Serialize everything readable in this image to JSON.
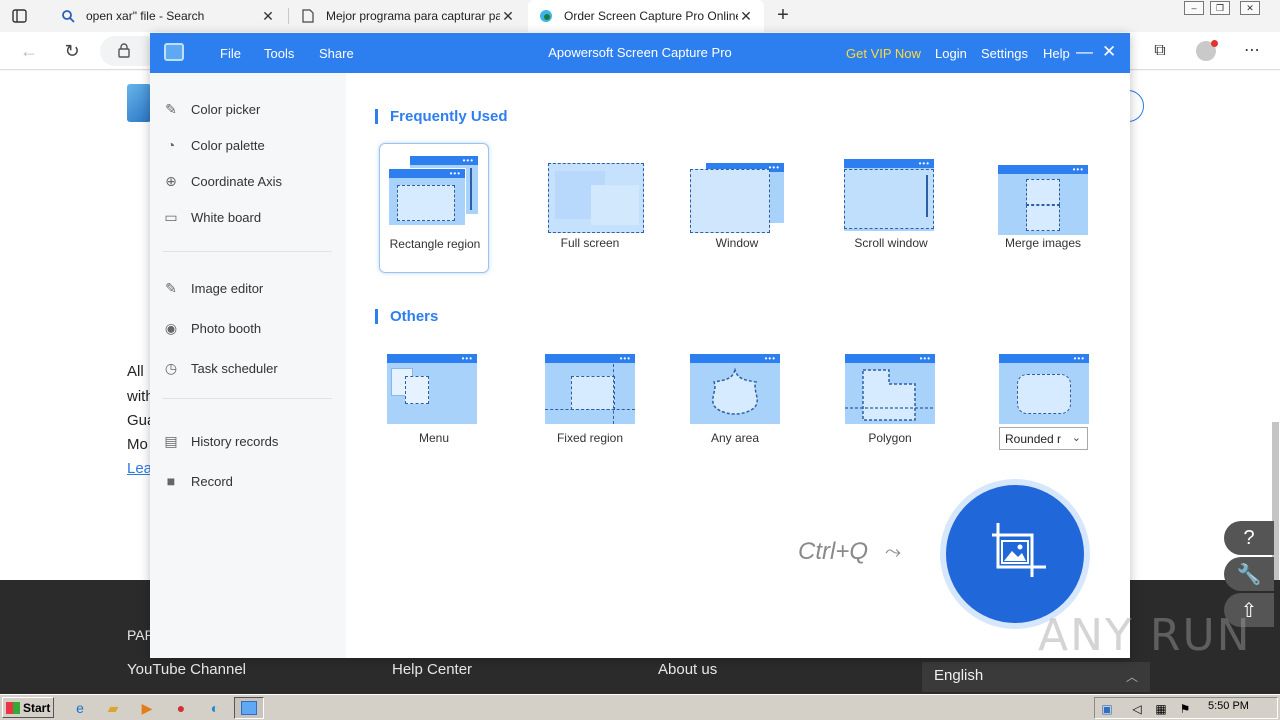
{
  "browser": {
    "tabs": [
      {
        "title": "open xar\" file - Search",
        "icon": "search-icon"
      },
      {
        "title": "Mejor programa para capturar pa",
        "icon": "page-icon"
      },
      {
        "title": "Order Screen Capture Pro Online",
        "icon": "edge-icon"
      }
    ],
    "new_tab_glyph": "+"
  },
  "webpage": {
    "text_lines": [
      "All",
      "with",
      "Gua",
      "Mo"
    ],
    "link_text": "Lea",
    "footer_head": "PAR",
    "footer_links": [
      "YouTube Channel",
      "Help Center",
      "About us"
    ],
    "language": "English"
  },
  "app": {
    "name": "Apowersoft Screen Capture Pro",
    "menu": [
      "File",
      "Tools",
      "Share"
    ],
    "vip_label": "Get VIP Now",
    "login_label": "Login",
    "settings_label": "Settings",
    "help_label": "Help",
    "sidebar": {
      "group1": [
        "Color picker",
        "Color palette",
        "Coordinate Axis",
        "White board"
      ],
      "group2": [
        "Image editor",
        "Photo booth",
        "Task scheduler"
      ],
      "group3": [
        "History records",
        "Record"
      ]
    },
    "frequently_used_title": "Frequently Used",
    "frequently_used": [
      "Rectangle region",
      "Full screen",
      "Window",
      "Scroll window",
      "Merge images"
    ],
    "others_title": "Others",
    "others": [
      "Menu",
      "Fixed region",
      "Any area",
      "Polygon"
    ],
    "shape_select": "Rounded r",
    "hotkey": "Ctrl+Q"
  },
  "taskbar": {
    "start_label": "Start",
    "clock": "5:50 PM"
  },
  "watermark": "ANY RUN"
}
